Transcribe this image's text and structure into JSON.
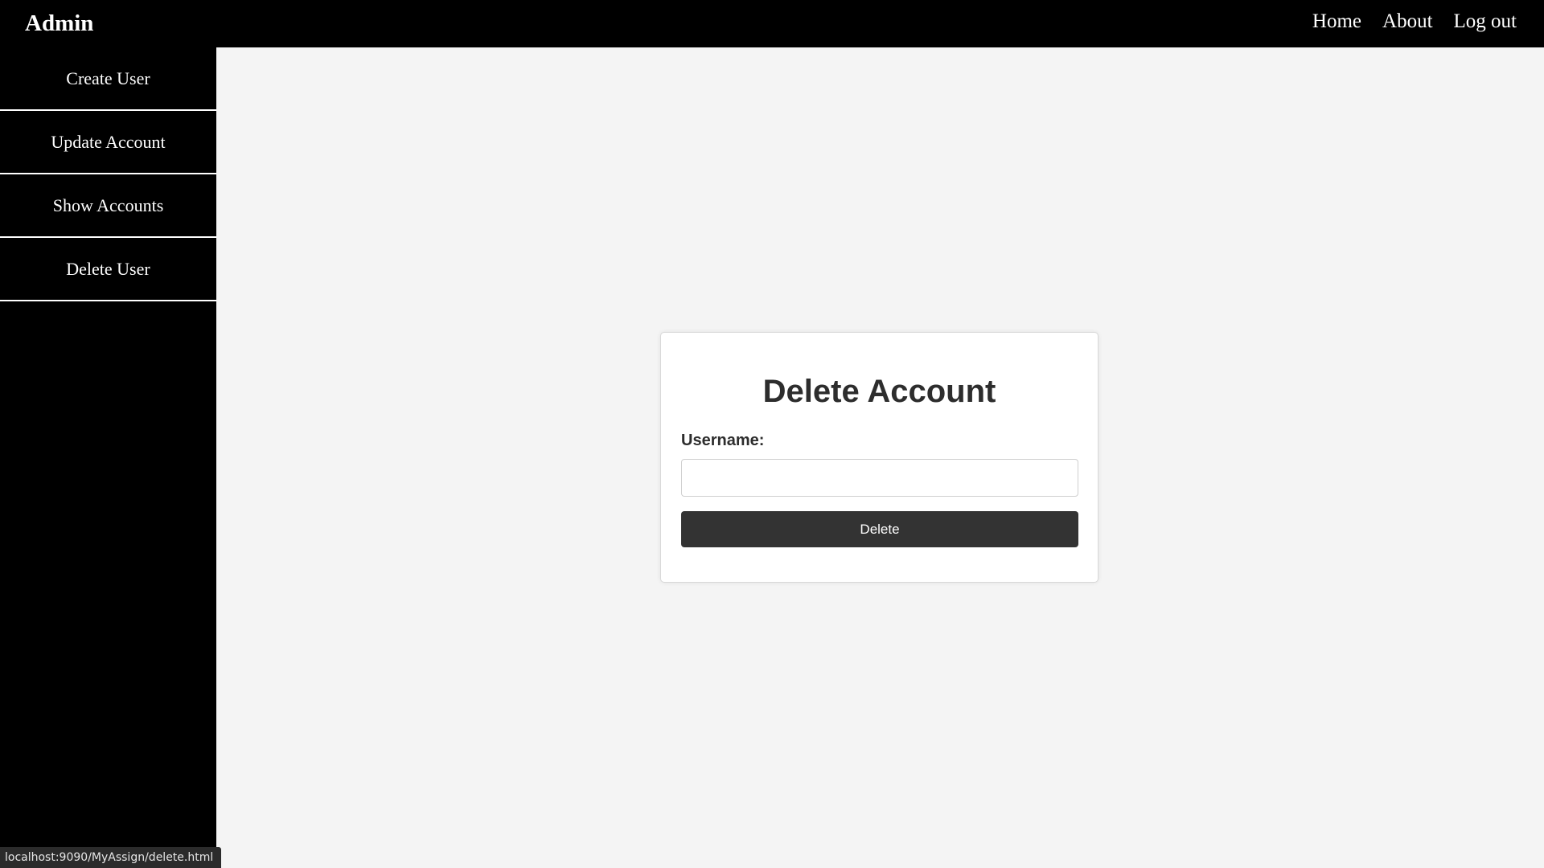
{
  "header": {
    "brand": "Admin",
    "nav": [
      {
        "label": "Home"
      },
      {
        "label": "About"
      },
      {
        "label": "Log out"
      }
    ]
  },
  "sidebar": {
    "items": [
      {
        "label": "Create User"
      },
      {
        "label": "Update Account"
      },
      {
        "label": "Show Accounts"
      },
      {
        "label": "Delete User"
      }
    ]
  },
  "form": {
    "title": "Delete Account",
    "username_label": "Username:",
    "username_value": "",
    "submit_label": "Delete"
  },
  "status_bar": {
    "url": "localhost:9090/MyAssign/delete.html"
  },
  "colors": {
    "topbar_bg": "#000000",
    "sidebar_bg": "#000000",
    "page_bg": "#f4f4f4",
    "button_bg": "#333333"
  }
}
